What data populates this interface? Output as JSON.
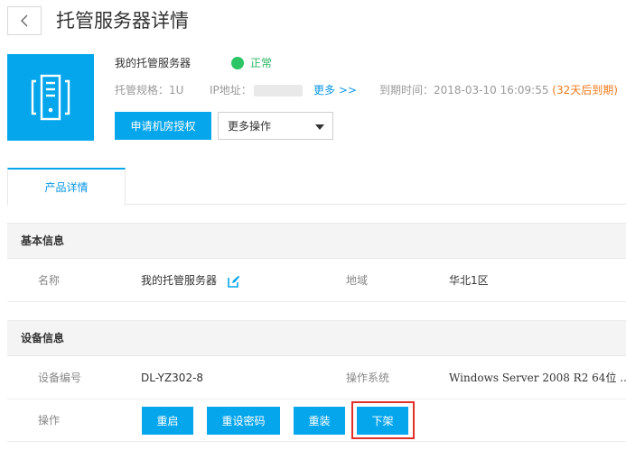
{
  "header": {
    "title": "托管服务器详情"
  },
  "server": {
    "name": "我的托管服务器",
    "status": "正常",
    "spec_label": "托管规格：",
    "spec_value": "1U",
    "ip_label": "IP地址：",
    "more_link": "更多 >>",
    "expire_label": "到期时间：",
    "expire_value": "2018-03-10 16:09:55",
    "expire_note": "(32天后到期)"
  },
  "actions": {
    "apply_label": "申请机房授权",
    "more_ops_label": "更多操作"
  },
  "tabs": [
    {
      "label": "产品详情",
      "active": true
    }
  ],
  "basic_info": {
    "title": "基本信息",
    "name_label": "名称",
    "name_value": "我的托管服务器",
    "region_label": "地域",
    "region_value": "华北1区"
  },
  "device_info": {
    "title": "设备信息",
    "device_no_label": "设备编号",
    "device_no_value": "DL-YZ302-8",
    "os_label": "操作系统",
    "os_value": "Windows Server 2008 R2 64位 ...",
    "ops_label": "操作",
    "buttons": {
      "restart": "重启",
      "reset_pwd": "重设密码",
      "reinstall": "重装",
      "offline": "下架"
    }
  },
  "colors": {
    "accent": "#06a6ec",
    "status_green": "#2bc566",
    "warn_orange": "#f07a1a",
    "highlight_red": "#e0302a"
  }
}
